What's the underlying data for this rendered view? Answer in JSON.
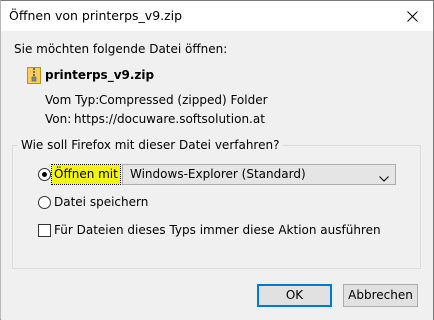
{
  "window": {
    "title": "Öffnen von printerps_v9.zip"
  },
  "dialog": {
    "prompt": "Sie möchten folgende Datei öffnen:",
    "file": {
      "name": "printerps_v9.zip",
      "icon": "zip-folder-icon",
      "type_label": "Vom Typ:",
      "type_value": "Compressed (zipped) Folder",
      "from_label": "Von:",
      "from_value": "https://docuware.softsolution.at"
    },
    "action_group": {
      "legend": "Wie soll Firefox mit dieser Datei verfahren?",
      "open_with": {
        "label": "Öffnen mit",
        "selected": true,
        "highlight_color": "#f4f414"
      },
      "app_select": {
        "value": "Windows-Explorer (Standard)"
      },
      "save_file": {
        "label": "Datei speichern",
        "selected": false
      },
      "always_do": {
        "label": "Für Dateien dieses Typs immer diese Aktion ausführen",
        "checked": false
      }
    },
    "buttons": {
      "ok": "OK",
      "cancel": "Abbrechen"
    }
  },
  "colors": {
    "dialog_bg": "#f0f0f0",
    "titlebar_bg": "#ffffff",
    "default_button_border": "#0078d7"
  }
}
